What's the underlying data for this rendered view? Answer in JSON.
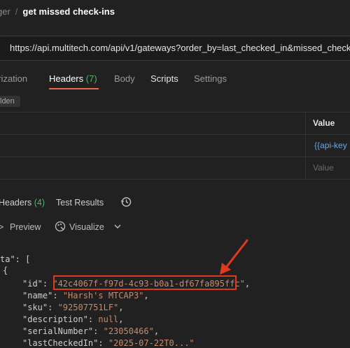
{
  "breadcrumb": {
    "parent": "ger",
    "separator": "/",
    "title": "get missed check-ins"
  },
  "request": {
    "url": "https://api.multitech.com/api/v1/gateways?order_by=last_checked_in&missed_check_ins"
  },
  "request_tabs": [
    {
      "label": "orization"
    },
    {
      "label": "Headers",
      "count": "(7)",
      "active": true
    },
    {
      "label": "Body"
    },
    {
      "label": "Scripts"
    },
    {
      "label": "Settings"
    }
  ],
  "hidden_chip": "lden",
  "headers_table": {
    "value_column": "Value",
    "row1_value": "{{api-key",
    "row2_placeholder": "Value"
  },
  "response_tabs": [
    {
      "label": "Headers",
      "count": "(4)"
    },
    {
      "label": "Test Results"
    }
  ],
  "view_controls": {
    "preview": "Preview",
    "visualize": "Visualize"
  },
  "json_body": {
    "line1_key": "ta",
    "line1_tail": "\": [",
    "line2": "{",
    "fields": [
      {
        "key": "\"id\"",
        "value": "\"42c4067f-f97d-4c93-b0a1-df67fa895ffc\"",
        "comma": ","
      },
      {
        "key": "\"name\"",
        "value": "\"Harsh's MTCAP3\"",
        "comma": ","
      },
      {
        "key": "\"sku\"",
        "value": "\"92507751LF\"",
        "comma": ","
      },
      {
        "key": "\"description\"",
        "value": "null",
        "comma": ","
      },
      {
        "key": "\"serialNumber\"",
        "value": "\"23050466\"",
        "comma": ","
      },
      {
        "key": "\"lastCheckedIn\"",
        "value": "\"2025-07-22T0...\"",
        "comma": ""
      }
    ]
  },
  "colors": {
    "accent": "#e9694a",
    "count_green": "#4fb36c",
    "annotation_red": "#e03a1e",
    "string_value": "#c88a6a",
    "variable_blue": "#6ba6e0"
  }
}
